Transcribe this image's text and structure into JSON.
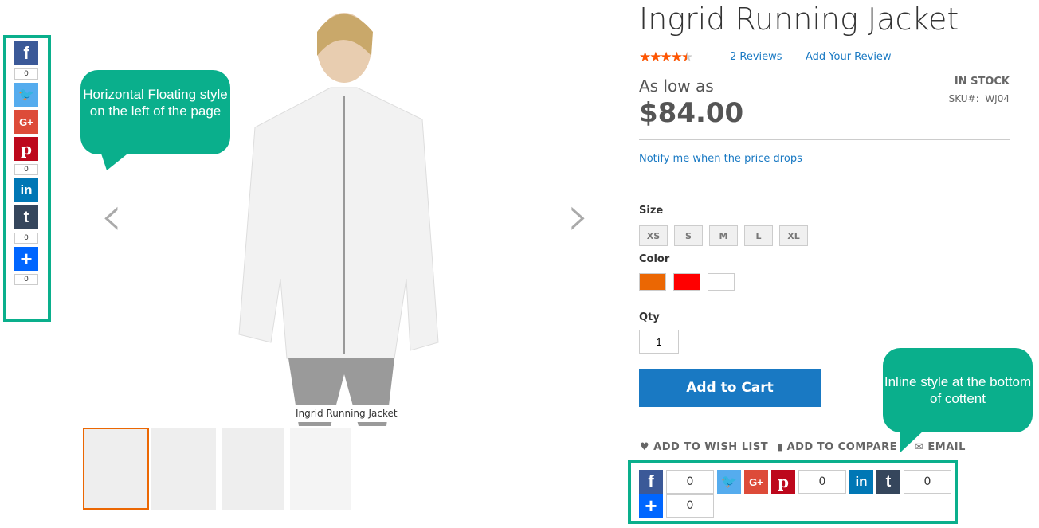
{
  "product": {
    "title": "Ingrid Running Jacket",
    "rating_percent": 90,
    "reviews_link": "2  Reviews",
    "add_review_link": "Add Your Review",
    "price_label": "As low as",
    "price": "$84.00",
    "stock": "IN STOCK",
    "sku_label": "SKU#:",
    "sku": "WJ04",
    "notify_link": "Notify me when the price drops",
    "size_label": "Size",
    "sizes": [
      "XS",
      "S",
      "M",
      "L",
      "XL"
    ],
    "color_label": "Color",
    "colors": [
      "#eb6703",
      "#ff0000",
      "#ffffff"
    ],
    "qty_label": "Qty",
    "qty": "1",
    "add_to_cart": "Add to Cart",
    "actions": {
      "wishlist": "ADD TO WISH LIST",
      "compare": "ADD TO COMPARE",
      "email": "EMAIL"
    }
  },
  "gallery": {
    "caption": "Ingrid Running Jacket"
  },
  "float_share": {
    "counts": {
      "facebook": "0",
      "pinterest": "0",
      "tumblr": "0",
      "addthis": "0"
    }
  },
  "inline_share": {
    "counts": {
      "facebook": "0",
      "pinterest": "0",
      "tumblr": "0",
      "addthis": "0"
    }
  },
  "callouts": {
    "left": "Horizontal Floating style on the left of the page",
    "right": "Inline style at the bottom of cottent"
  },
  "brand_colors": {
    "facebook": "#3b5998",
    "twitter": "#55acee",
    "googleplus": "#dd4b39",
    "pinterest": "#bd081c",
    "linkedin": "#0077b5",
    "tumblr": "#35465c",
    "addthis": "#0066ff",
    "accent": "#0aaf8c",
    "button": "#1979c3",
    "star": "#ff5501"
  }
}
